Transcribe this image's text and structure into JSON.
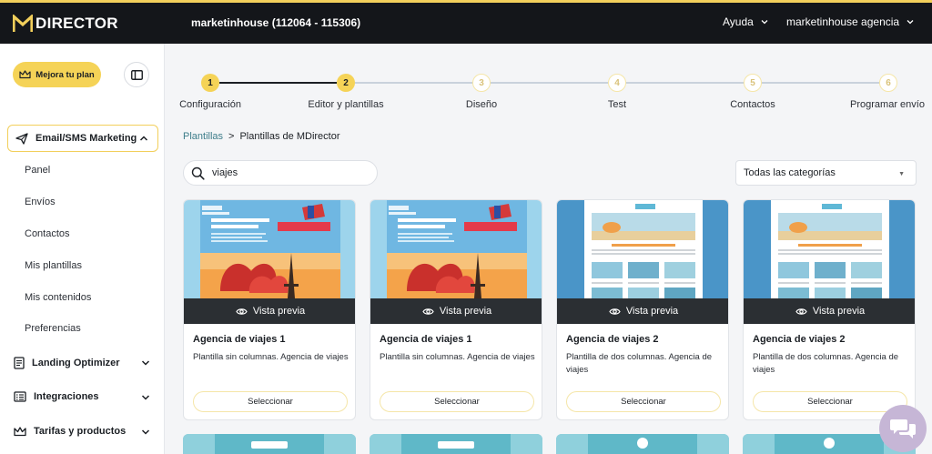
{
  "header": {
    "logo_text": "DIRECTOR",
    "account": "marketinhouse (112064 - 115306)",
    "help": "Ayuda",
    "user": "marketinhouse agencia"
  },
  "sidebar": {
    "upgrade_label": "Mejora tu plan",
    "section": "Email/SMS Marketing",
    "subitems": [
      "Panel",
      "Envíos",
      "Contactos",
      "Mis plantillas",
      "Mis contenidos",
      "Preferencias"
    ],
    "groups": [
      "Landing Optimizer",
      "Integraciones",
      "Tarifas y productos"
    ]
  },
  "stepper": {
    "steps": [
      {
        "num": "1",
        "label": "Configuración",
        "state": "done"
      },
      {
        "num": "2",
        "label": "Editor y plantillas",
        "state": "current"
      },
      {
        "num": "3",
        "label": "Diseño",
        "state": "pending"
      },
      {
        "num": "4",
        "label": "Test",
        "state": "pending"
      },
      {
        "num": "5",
        "label": "Contactos",
        "state": "pending"
      },
      {
        "num": "6",
        "label": "Programar envío",
        "state": "pending"
      }
    ]
  },
  "breadcrumb": {
    "root": "Plantillas",
    "separator": ">",
    "current": "Plantillas de MDirector"
  },
  "search": {
    "value": "viajes",
    "placeholder": ""
  },
  "category": {
    "selected": "Todas las categorías"
  },
  "templates": [
    {
      "title": "Agencia de viajes 1",
      "description": "Plantilla sin columnas. Agencia de viajes",
      "preview_label": "Vista previa",
      "button_label": "Seleccionar",
      "thumb": "paris"
    },
    {
      "title": "Agencia de viajes 1",
      "description": "Plantilla sin columnas. Agencia de viajes",
      "preview_label": "Vista previa",
      "button_label": "Seleccionar",
      "thumb": "paris"
    },
    {
      "title": "Agencia de viajes 2",
      "description": "Plantilla de dos columnas. Agencia de viajes",
      "preview_label": "Vista previa",
      "button_label": "Seleccionar",
      "thumb": "beach"
    },
    {
      "title": "Agencia de viajes 2",
      "description": "Plantilla de dos columnas. Agencia de viajes",
      "preview_label": "Vista previa",
      "button_label": "Seleccionar",
      "thumb": "beach"
    }
  ],
  "colors": {
    "accent": "#f5d357",
    "topbar": "#14161a",
    "link": "#3d7d8a"
  }
}
